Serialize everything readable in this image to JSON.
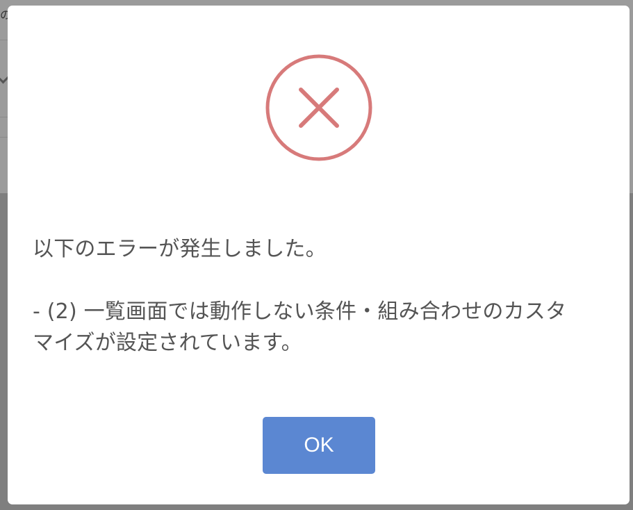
{
  "colors": {
    "error_icon": "#d77a7a",
    "ok_button_bg": "#5b87d2",
    "message_text": "#545454"
  },
  "background": {
    "partial_text": "の"
  },
  "dialog": {
    "icon": "error-x-circle-icon",
    "message_line1": "以下のエラーが発生しました。",
    "message_line2": "- (2) 一覧画面では動作しない条件・組み合わせのカスタ",
    "message_line3": "マイズが設定されています。",
    "ok_label": "OK"
  }
}
